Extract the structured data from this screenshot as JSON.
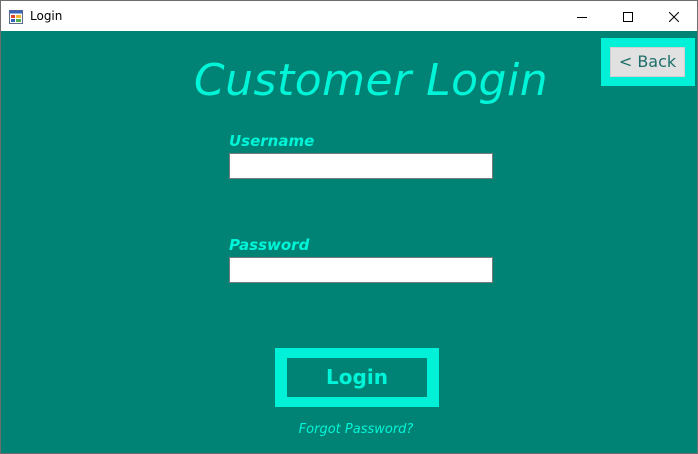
{
  "window": {
    "title": "Login",
    "controls": {
      "minimize": "minimize",
      "maximize": "maximize",
      "close": "close"
    },
    "icons": {
      "app": "form-app-icon",
      "minimize": "minimize-icon",
      "maximize": "maximize-icon",
      "close": "close-icon"
    }
  },
  "form": {
    "heading": "Customer Login",
    "back_label": "< Back",
    "username": {
      "label": "Username",
      "value": "",
      "placeholder": ""
    },
    "password": {
      "label": "Password",
      "value": "",
      "placeholder": ""
    },
    "login_label": "Login",
    "forgot_label": "Forgot Password?"
  },
  "colors": {
    "background": "#008374",
    "accent": "#00f5d8",
    "frame": "#00f1d8",
    "back_button_bg": "#e1e1e1",
    "back_button_text": "#1c6e6a",
    "titlebar": "#ffffff"
  }
}
